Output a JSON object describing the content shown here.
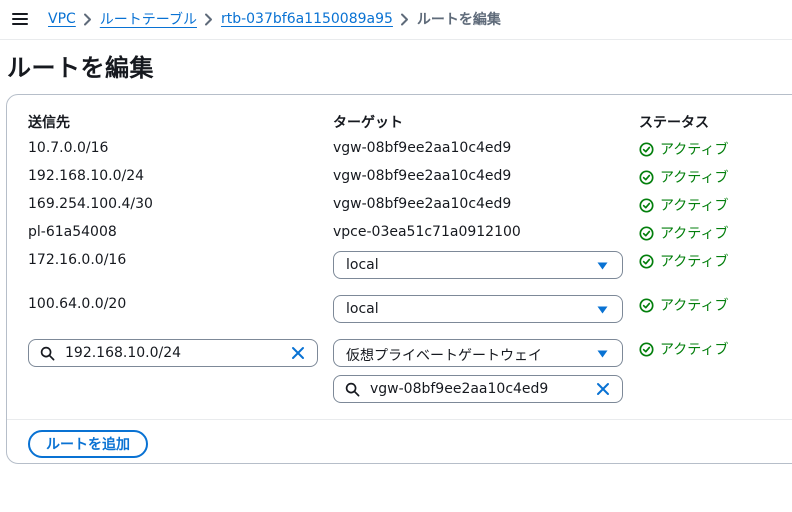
{
  "breadcrumb": {
    "items": [
      "VPC",
      "ルートテーブル",
      "rtb-037bf6a1150089a95"
    ],
    "current": "ルートを編集"
  },
  "page": {
    "title": "ルートを編集"
  },
  "table": {
    "headers": {
      "destination": "送信先",
      "target": "ターゲット",
      "status": "ステータス"
    },
    "rows": [
      {
        "destination": "10.7.0.0/16",
        "target": "vgw-08bf9ee2aa10c4ed9",
        "status": "アクティブ"
      },
      {
        "destination": "192.168.10.0/24",
        "target": "vgw-08bf9ee2aa10c4ed9",
        "status": "アクティブ"
      },
      {
        "destination": "169.254.100.4/30",
        "target": "vgw-08bf9ee2aa10c4ed9",
        "status": "アクティブ"
      },
      {
        "destination": "pl-61a54008",
        "target": "vpce-03ea51c71a0912100",
        "status": "アクティブ"
      },
      {
        "destination": "172.16.0.0/16",
        "target": "local",
        "status": "アクティブ"
      },
      {
        "destination": "100.64.0.0/20",
        "target": "local",
        "status": "アクティブ"
      },
      {
        "destination": "192.168.10.0/24",
        "target_type": "仮想プライベートゲートウェイ",
        "target": "vgw-08bf9ee2aa10c4ed9",
        "status": "アクティブ"
      }
    ]
  },
  "add_route_label": "ルートを追加",
  "icons": {
    "menu": "hamburger-icon",
    "breadcrumb_separator": "chevron-right-icon",
    "status": "check-circle-icon",
    "dropdown": "caret-down-icon",
    "search": "search-icon",
    "clear": "close-icon"
  },
  "colors": {
    "link": "#0972d3",
    "success": "#037f0c",
    "text": "#16191f",
    "muted": "#5f6b7a",
    "border": "#7d8998"
  }
}
